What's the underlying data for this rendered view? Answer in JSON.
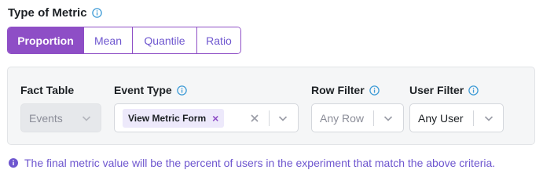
{
  "section": {
    "title": "Type of Metric",
    "title_icon": "info-icon"
  },
  "metric_types": {
    "options": [
      "Proportion",
      "Mean",
      "Quantile",
      "Ratio"
    ],
    "selected": "Proportion"
  },
  "fields": {
    "fact_table": {
      "label": "Fact Table",
      "value": "Events",
      "disabled": true
    },
    "event_type": {
      "label": "Event Type",
      "chip": "View Metric Form"
    },
    "row_filter": {
      "label": "Row Filter",
      "placeholder": "Any Row"
    },
    "user_filter": {
      "label": "User Filter",
      "value": "Any User"
    }
  },
  "note": {
    "text": "The final metric value will be the percent of users in the experiment that match the above criteria."
  },
  "colors": {
    "accent": "#8e4ec6",
    "accent_text": "#6e56cf",
    "info_blue": "#3e9bd6",
    "panel_bg": "#f5f6f7"
  }
}
